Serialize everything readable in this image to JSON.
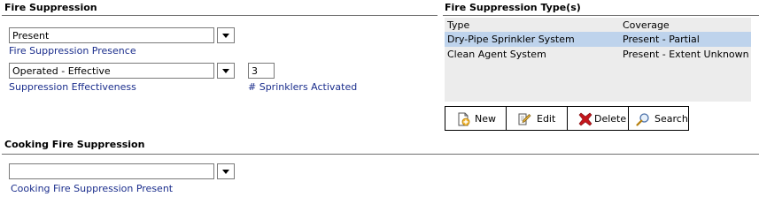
{
  "fire_suppression": {
    "title": "Fire Suppression",
    "presence": {
      "value": "Present",
      "caption": "Fire Suppression Presence"
    },
    "effectiveness": {
      "value": "Operated - Effective",
      "caption": "Suppression Effectiveness"
    },
    "sprinklers": {
      "value": "3",
      "caption": "# Sprinklers Activated"
    }
  },
  "suppression_types": {
    "title": "Fire Suppression Type(s)",
    "columns": [
      "Type",
      "Coverage"
    ],
    "rows": [
      {
        "type": "Dry-Pipe Sprinkler System",
        "coverage": "Present - Partial",
        "selected": true
      },
      {
        "type": "Clean Agent System",
        "coverage": "Present - Extent Unknown",
        "selected": false
      }
    ],
    "toolbar": {
      "new": "New",
      "edit": "Edit",
      "delete": "Delete",
      "search": "Search"
    }
  },
  "cooking": {
    "title": "Cooking Fire Suppression",
    "present": {
      "value": "",
      "caption": "Cooking Fire Suppression Present"
    }
  },
  "colors": {
    "caption": "#1a2d8c",
    "grid_bg": "#ececec",
    "selected_row": "#bed3ec",
    "delete_icon": "#c4161c"
  }
}
